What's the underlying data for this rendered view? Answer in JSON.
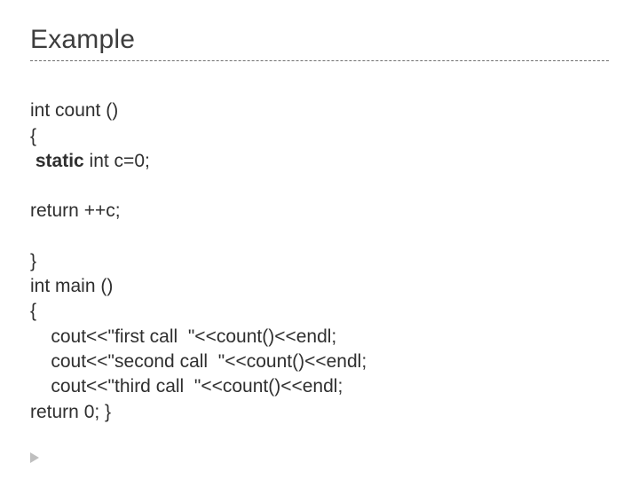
{
  "title": "Example",
  "code": {
    "l1a": "int count ()",
    "l1b": "{",
    "l2_lead": " ",
    "l2_kw": "static",
    "l2_rest": " int c=0;",
    "l3": "return ++c;",
    "l4a": "}",
    "l4b": "int main ()",
    "l4c": "{",
    "l5": "    cout<<\"first call  \"<<count()<<endl;",
    "l6": "    cout<<\"second call  \"<<count()<<endl;",
    "l7": "    cout<<\"third call  \"<<count()<<endl;",
    "l8": "return 0; }"
  }
}
